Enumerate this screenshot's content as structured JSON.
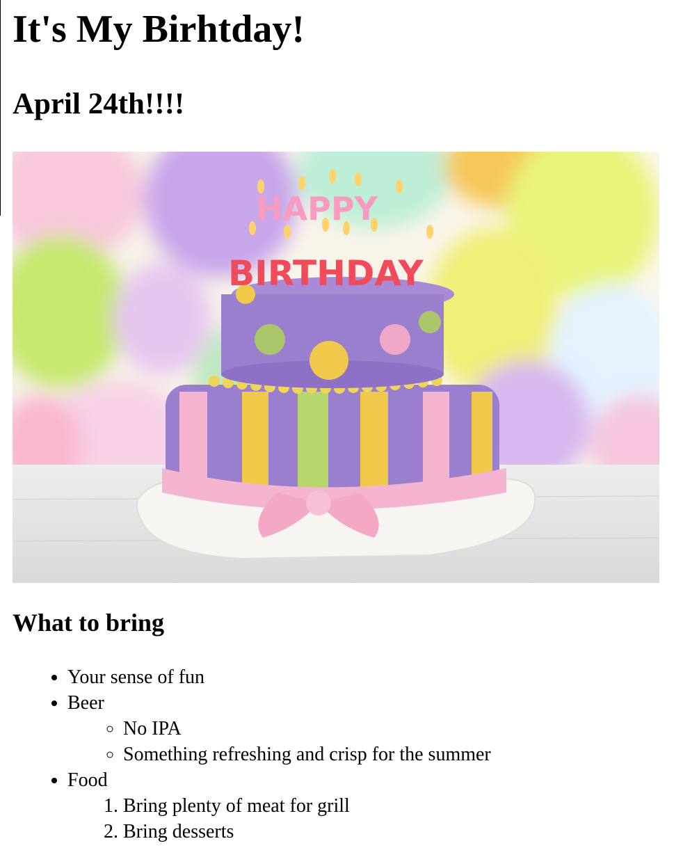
{
  "title": "It's My Birhtday!",
  "date": "April 24th!!!!",
  "image": {
    "cake_top_text": "HAPPY",
    "cake_bottom_text": "BIRTHDAY"
  },
  "bring_heading": "What to bring",
  "items": [
    {
      "label": "Your sense of fun"
    },
    {
      "label": "Beer",
      "sub": [
        "No IPA",
        "Something refreshing and crisp for the summer"
      ]
    },
    {
      "label": "Food",
      "sub": [
        "Bring plenty of meat for grill",
        "Bring desserts"
      ]
    }
  ],
  "colors": {
    "cake_purple": "#9b7fcf",
    "ribbon_pink": "#f4b4cf",
    "ribbon_yellow": "#f0c94a",
    "ribbon_green": "#b5d66a"
  }
}
